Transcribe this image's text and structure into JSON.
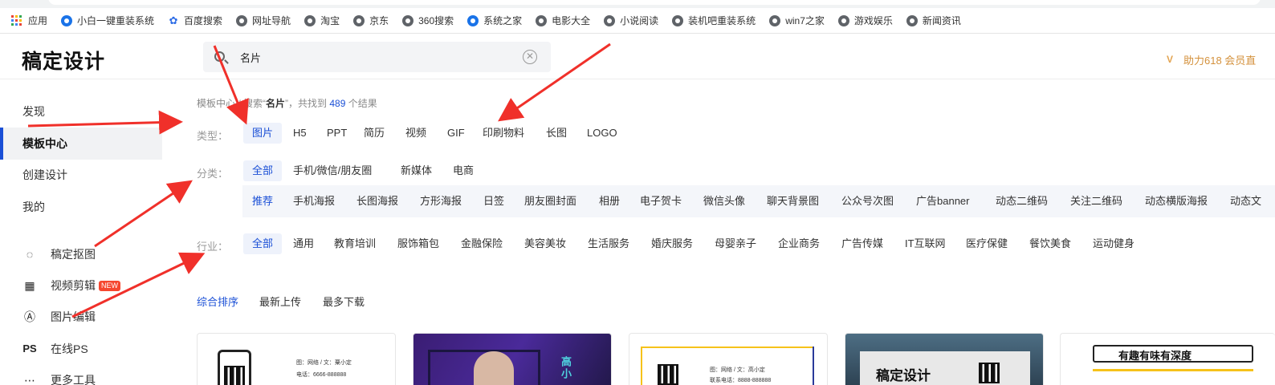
{
  "bookmarks": [
    {
      "label": "应用",
      "icon": "apps-grid-icon"
    },
    {
      "label": "小白一键重装系统",
      "icon": "blue-star-icon"
    },
    {
      "label": "百度搜索",
      "icon": "baidu-paw-icon"
    },
    {
      "label": "网址导航",
      "icon": "globe-icon"
    },
    {
      "label": "淘宝",
      "icon": "globe-icon"
    },
    {
      "label": "京东",
      "icon": "globe-icon"
    },
    {
      "label": "360搜索",
      "icon": "globe-icon"
    },
    {
      "label": "系统之家",
      "icon": "blue-star-icon"
    },
    {
      "label": "电影大全",
      "icon": "globe-icon"
    },
    {
      "label": "小说阅读",
      "icon": "globe-icon"
    },
    {
      "label": "装机吧重装系统",
      "icon": "globe-icon"
    },
    {
      "label": "win7之家",
      "icon": "globe-icon"
    },
    {
      "label": "游戏娱乐",
      "icon": "globe-icon"
    },
    {
      "label": "新闻资讯",
      "icon": "globe-icon"
    }
  ],
  "header": {
    "logo": "稿定设计",
    "search_value": "名片",
    "promo": "助力618 会员直"
  },
  "sidebar": {
    "nav": [
      "发现",
      "模板中心",
      "创建设计",
      "我的"
    ],
    "active_nav": "模板中心",
    "tools": [
      {
        "label": "稿定抠图",
        "icon": "cutout-icon"
      },
      {
        "label": "视频剪辑",
        "icon": "film-icon",
        "badge": "NEW"
      },
      {
        "label": "图片编辑",
        "icon": "image-edit-icon"
      },
      {
        "label": "在线PS",
        "icon": "ps-icon"
      },
      {
        "label": "更多工具",
        "icon": "more-icon"
      }
    ]
  },
  "breadcrumb": {
    "root": "模板中心",
    "sep": " / 搜索“",
    "query": "名片",
    "mid": "”，共找到 ",
    "count": "489",
    "tail": " 个结果"
  },
  "filters": {
    "type_label": "类型：",
    "types": [
      "图片",
      "H5",
      "PPT",
      "简历",
      "视频",
      "GIF",
      "印刷物料",
      "长图",
      "LOGO"
    ],
    "category_label": "分类：",
    "categories": [
      "全部",
      "手机/微信/朋友圈",
      "新媒体",
      "电商"
    ],
    "subcategories": [
      "推荐",
      "手机海报",
      "长图海报",
      "方形海报",
      "日签",
      "朋友圈封面",
      "相册",
      "电子贺卡",
      "微信头像",
      "聊天背景图",
      "公众号次图",
      "广告banner",
      "动态二维码",
      "关注二维码",
      "动态横版海报",
      "动态文"
    ],
    "industry_label": "行业：",
    "industries": [
      "全部",
      "通用",
      "教育培训",
      "服饰箱包",
      "金融保险",
      "美容美妆",
      "生活服务",
      "婚庆服务",
      "母婴亲子",
      "企业商务",
      "广告传媒",
      "IT互联网",
      "医疗保健",
      "餐饮美食",
      "运动健身"
    ]
  },
  "sort": [
    "综合排序",
    "最新上传",
    "最多下载"
  ],
  "cards": {
    "card1_line1": "图：网络 / 文：粟小定",
    "card1_line2": "电话：6666-888888",
    "card2_name": "高小",
    "card3_line1": "图：网络 / 文：高小定",
    "card3_line2": "联系电话：8888-888888",
    "card4_title": "稿定设计",
    "card5_title": "有趣有味有深度"
  },
  "colors": {
    "accent": "#1a4fd6",
    "arrow": "#f0302a",
    "promo": "#d4913c"
  }
}
